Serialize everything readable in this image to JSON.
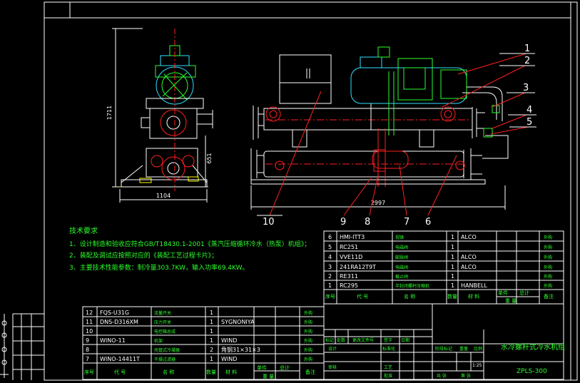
{
  "drawing": {
    "dimensions": {
      "width_overall": "2997",
      "width_side": "1104",
      "height_overall": "1711",
      "height_mid": "651"
    },
    "callouts": [
      "1",
      "2",
      "3",
      "4",
      "5",
      "6",
      "7",
      "8",
      "9",
      "10"
    ]
  },
  "tech_notes": {
    "title": "技术要求",
    "lines": [
      "1、设计制造和验收应符合GB/T18430.1-2001《蒸汽压缩循环冷水（热泵）机组》；",
      "2、装配及调试应按照对应的《装配工艺过程卡片》；",
      "3、主要技术性能参数：制冷量303.7KW，输入功率69.4KW。"
    ]
  },
  "bom_upper": {
    "rows": [
      {
        "no": "6",
        "code": "HMI-ITT3",
        "name": "视镜",
        "qty": "1",
        "mat": "ALCO",
        "note": "外购"
      },
      {
        "no": "5",
        "code": "RC251",
        "name": "电磁阀",
        "qty": "1",
        "mat": "",
        "note": "外购"
      },
      {
        "no": "4",
        "code": "VVE11D",
        "name": "膨胀阀",
        "qty": "1",
        "mat": "ALCO",
        "note": "外购"
      },
      {
        "no": "3",
        "code": "241RA12T9T",
        "name": "电磁阀",
        "qty": "1",
        "mat": "ALCO",
        "note": "外购"
      },
      {
        "no": "2",
        "code": "RE311",
        "name": "截止阀",
        "qty": "1",
        "mat": "",
        "note": "外购"
      },
      {
        "no": "1",
        "code": "RC295",
        "name": "半封闭螺杆压缩机",
        "qty": "1",
        "mat": "HANBELL",
        "note": "外购"
      }
    ],
    "header": {
      "no": "序号",
      "code": "代  号",
      "name": "名    称",
      "qty": "数量",
      "mat": "材  料",
      "unit": "单件",
      "total": "总计",
      "weight": "重    量",
      "note": "备注"
    }
  },
  "bom_lower": {
    "rows": [
      {
        "no": "12",
        "code": "FQS-U31G",
        "name": "流量开关",
        "qty": "1",
        "mat": "",
        "note": "外购"
      },
      {
        "no": "11",
        "code": "DNS-D316XM",
        "name": "压力开关",
        "qty": "1",
        "mat": "SYGNONIYA",
        "note": "外购"
      },
      {
        "no": "10",
        "code": "",
        "name": "电控箱总成",
        "qty": "1",
        "mat": "",
        "note": "外购"
      },
      {
        "no": "9",
        "code": "WINO-11",
        "name": "机架",
        "qty": "1",
        "mat": "WIND",
        "note": "外购"
      },
      {
        "no": "8",
        "code": "",
        "name": "壳管式冷凝器",
        "qty": "2",
        "mat": "角钢31×31×3",
        "note": "外购"
      },
      {
        "no": "7",
        "code": "WINO-14411T",
        "name": "干燥过滤器",
        "qty": "1",
        "mat": "WIND",
        "note": "外购"
      }
    ],
    "header": {
      "no": "序号",
      "code": "代  号",
      "name": "名    称",
      "qty": "数量",
      "mat": "材    料",
      "unit": "单件",
      "total": "总计",
      "weight": "重    量",
      "note": "备注"
    }
  },
  "title_block": {
    "product_name": "水冷螺杆式冷水机组",
    "drawing_no": "ZPLS-300",
    "labels": [
      "标记",
      "处数",
      "更改文件号",
      "签字",
      "日期",
      "设计",
      "标准化",
      "审核",
      "工艺",
      "批准",
      "阶段标记",
      "重量",
      "比例",
      "共  张",
      "第  张"
    ],
    "scale": "1:25"
  }
}
